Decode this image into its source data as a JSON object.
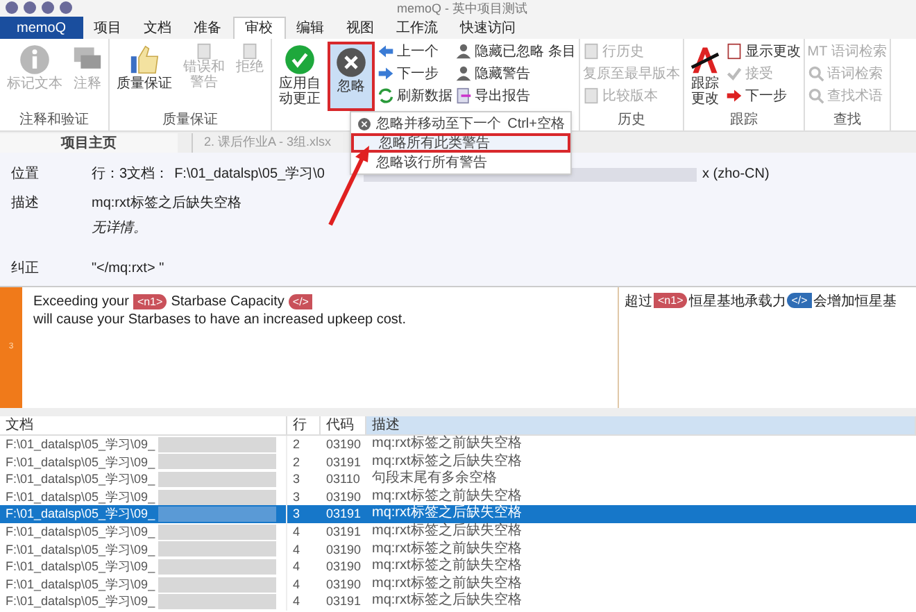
{
  "window": {
    "title": "memoQ - 英中项目测试"
  },
  "menu_tabs": [
    {
      "label": "memoQ",
      "kind": "app",
      "selected": false
    },
    {
      "label": "项目",
      "kind": "tab",
      "selected": false
    },
    {
      "label": "文档",
      "kind": "tab",
      "selected": false
    },
    {
      "label": "准备",
      "kind": "tab",
      "selected": false
    },
    {
      "label": "审校",
      "kind": "tab",
      "selected": true
    },
    {
      "label": "编辑",
      "kind": "tab",
      "selected": false
    },
    {
      "label": "视图",
      "kind": "tab",
      "selected": false
    },
    {
      "label": "工作流",
      "kind": "tab",
      "selected": false
    },
    {
      "label": "快速访问",
      "kind": "tab",
      "selected": false
    }
  ],
  "ribbon": {
    "groups": [
      {
        "label": "注释和验证",
        "items": [
          {
            "kind": "large",
            "label": "标记文本",
            "disabled": true
          },
          {
            "kind": "large",
            "label": "注释",
            "disabled": true
          }
        ]
      },
      {
        "label": "质量保证",
        "items": [
          {
            "kind": "large",
            "label": "质量保证",
            "disabled": false
          },
          {
            "kind": "large",
            "label": "错误和警告",
            "disabled": true
          },
          {
            "kind": "large",
            "label": "拒绝",
            "disabled": true
          }
        ]
      },
      {
        "items": [
          {
            "kind": "large",
            "label": "应用自动更正",
            "disabled": false
          },
          {
            "kind": "large",
            "label": "忽略",
            "disabled": false,
            "selected": true
          },
          {
            "kind": "small",
            "label": "上一个",
            "disabled": false
          },
          {
            "kind": "small",
            "label": "下一步",
            "disabled": false
          },
          {
            "kind": "small",
            "label": "刷新数据",
            "disabled": false
          },
          {
            "kind": "small",
            "label": "隐藏已忽略 条目",
            "disabled": false
          },
          {
            "kind": "small",
            "label": "隐藏警告",
            "disabled": false
          },
          {
            "kind": "small",
            "label": "导出报告",
            "disabled": false
          }
        ]
      },
      {
        "label": "历史",
        "items": [
          {
            "kind": "small",
            "label": "行历史",
            "disabled": true
          },
          {
            "kind": "small",
            "label": "复原至最早版本",
            "disabled": true
          },
          {
            "kind": "small",
            "label": "比较版本",
            "disabled": true
          }
        ]
      },
      {
        "label": "跟踪",
        "items": [
          {
            "kind": "large",
            "label": "跟踪更改",
            "disabled": false
          },
          {
            "kind": "small",
            "label": "显示更改",
            "disabled": false
          },
          {
            "kind": "small",
            "label": "接受",
            "disabled": true
          },
          {
            "kind": "small",
            "label": "下一步",
            "disabled": false
          }
        ]
      },
      {
        "label": "查找",
        "items": [
          {
            "kind": "small",
            "label": "MT 语词检索",
            "disabled": true
          },
          {
            "kind": "small",
            "label": "语词检索",
            "disabled": true
          },
          {
            "kind": "small",
            "label": "查找术语",
            "disabled": true
          }
        ]
      }
    ]
  },
  "dropdown_menu": [
    {
      "label": "忽略并移动至下一个",
      "shortcut": "Ctrl+空格",
      "selected": false
    },
    {
      "label": "忽略所有此类警告",
      "selected": true
    },
    {
      "label": "忽略该行所有警告",
      "selected": false
    }
  ],
  "doc_tabs": [
    {
      "label": "项目主页",
      "selected": true
    },
    {
      "label": "2. 课后作业A - 3组.xlsx",
      "selected": false
    }
  ],
  "details": [
    {
      "label": "位置",
      "parts": [
        "行：3文档：",
        "F:\\01_datalsp\\05_学习\\0",
        "x (zho-CN)"
      ]
    },
    {
      "label": "描述",
      "parts": [
        "mq:rxt标签之后缺失空格"
      ],
      "note": "无详情。"
    },
    {
      "label": "纠正",
      "parts": [
        "\"</mq:rxt> \""
      ]
    }
  ],
  "editor": {
    "segment_number": "3",
    "source": [
      {
        "kind": "text",
        "text": "Exceeding your "
      },
      {
        "kind": "open-tag",
        "text": "<n1>",
        "selected": false
      },
      {
        "kind": "text",
        "text": "Starbase Capacity "
      },
      {
        "kind": "close-tag",
        "text": "</>",
        "selected": false
      },
      {
        "kind": "text",
        "text": " will cause your Starbases to have an increased upkeep cost."
      }
    ],
    "target": [
      {
        "kind": "text",
        "text": "超过"
      },
      {
        "kind": "open-tag",
        "text": "<n1>",
        "selected": false
      },
      {
        "kind": "text",
        "text": "恒星基地承载力"
      },
      {
        "kind": "close-tag",
        "text": "</>",
        "selected": true
      },
      {
        "kind": "text",
        "text": "会增加恒星基"
      }
    ]
  },
  "table": {
    "columns": [
      "文档",
      "行",
      "代码",
      "描述"
    ],
    "rows": [
      {
        "document": "F:\\01_datalsp\\05_学习\\09_",
        "row": "2",
        "code": "03190",
        "description": "mq:rxt标签之前缺失空格",
        "selected": false
      },
      {
        "document": "F:\\01_datalsp\\05_学习\\09_",
        "row": "2",
        "code": "03191",
        "description": "mq:rxt标签之后缺失空格",
        "selected": false
      },
      {
        "document": "F:\\01_datalsp\\05_学习\\09_",
        "row": "3",
        "code": "03110",
        "description": "句段末尾有多余空格",
        "selected": false
      },
      {
        "document": "F:\\01_datalsp\\05_学习\\09_",
        "row": "3",
        "code": "03190",
        "description": "mq:rxt标签之前缺失空格",
        "selected": false
      },
      {
        "document": "F:\\01_datalsp\\05_学习\\09_",
        "row": "3",
        "code": "03191",
        "description": "mq:rxt标签之后缺失空格",
        "selected": true
      },
      {
        "document": "F:\\01_datalsp\\05_学习\\09_",
        "row": "4",
        "code": "03191",
        "description": "mq:rxt标签之后缺失空格",
        "selected": false
      },
      {
        "document": "F:\\01_datalsp\\05_学习\\09_",
        "row": "4",
        "code": "03190",
        "description": "mq:rxt标签之前缺失空格",
        "selected": false
      },
      {
        "document": "F:\\01_datalsp\\05_学习\\09_",
        "row": "4",
        "code": "03190",
        "description": "mq:rxt标签之前缺失空格",
        "selected": false
      },
      {
        "document": "F:\\01_datalsp\\05_学习\\09_",
        "row": "4",
        "code": "03190",
        "description": "mq:rxt标签之前缺失空格",
        "selected": false
      },
      {
        "document": "F:\\01_datalsp\\05_学习\\09_",
        "row": "4",
        "code": "03191",
        "description": "mq:rxt标签之后缺失空格",
        "selected": false
      }
    ]
  }
}
